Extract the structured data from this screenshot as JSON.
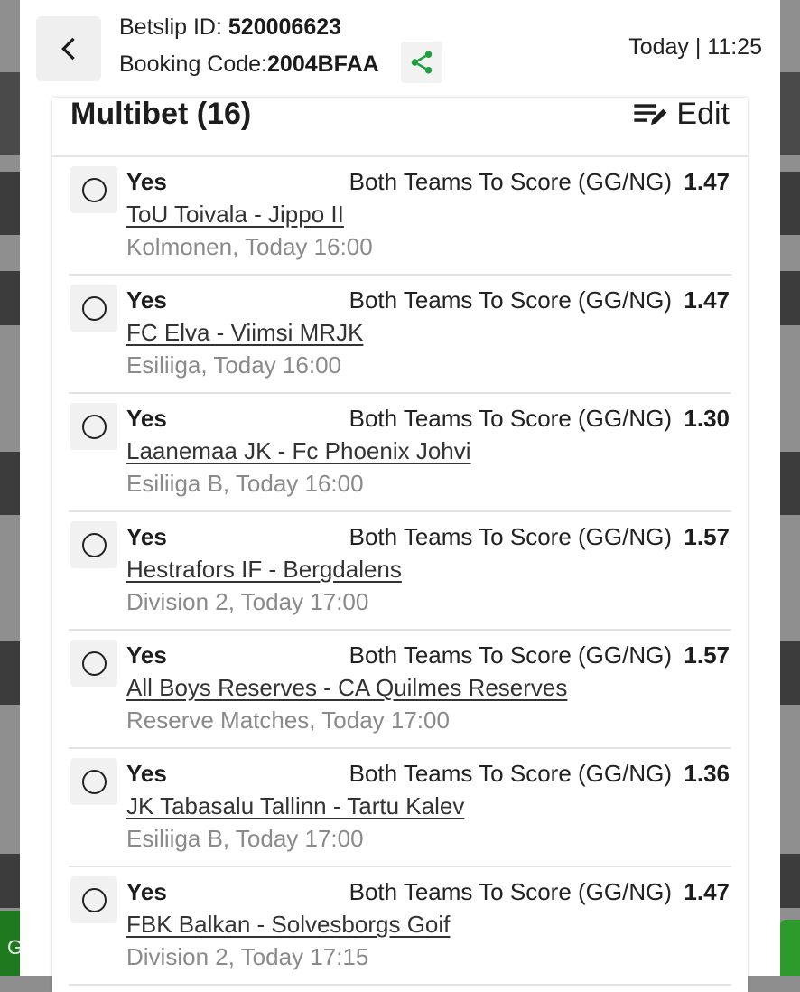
{
  "header": {
    "betslip_label": "Betslip ID:",
    "betslip_id": "520006623",
    "booking_label": "Booking Code:",
    "booking_code": "2004BFAA",
    "date_time": "Today | 11:25"
  },
  "card": {
    "title": "Multibet (16)",
    "edit_label": "Edit"
  },
  "bets": [
    {
      "pick": "Yes",
      "market": "Both Teams To Score (GG/NG)",
      "odds": "1.47",
      "match": "ToU Toivala - Jippo II",
      "league": "Kolmonen, Today 16:00"
    },
    {
      "pick": "Yes",
      "market": "Both Teams To Score (GG/NG)",
      "odds": "1.47",
      "match": "FC Elva - Viimsi MRJK",
      "league": "Esiliiga, Today 16:00"
    },
    {
      "pick": "Yes",
      "market": "Both Teams To Score (GG/NG)",
      "odds": "1.30",
      "match": "Laanemaa JK - Fc Phoenix Johvi",
      "league": "Esiliiga B, Today 16:00"
    },
    {
      "pick": "Yes",
      "market": "Both Teams To Score (GG/NG)",
      "odds": "1.57",
      "match": "Hestrafors IF - Bergdalens",
      "league": "Division 2, Today 17:00"
    },
    {
      "pick": "Yes",
      "market": "Both Teams To Score (GG/NG)",
      "odds": "1.57",
      "match": "All Boys Reserves - CA Quilmes Reserves",
      "league": "Reserve Matches, Today 17:00"
    },
    {
      "pick": "Yes",
      "market": "Both Teams To Score (GG/NG)",
      "odds": "1.36",
      "match": "JK Tabasalu Tallinn - Tartu Kalev",
      "league": "Esiliiga B, Today 17:00"
    },
    {
      "pick": "Yes",
      "market": "Both Teams To Score (GG/NG)",
      "odds": "1.47",
      "match": "FBK Balkan - Solvesborgs Goif",
      "league": "Division 2, Today 17:15"
    }
  ],
  "background": {
    "partial_text": "G"
  },
  "colors": {
    "accent_green": "#1e9e3e",
    "text_dark": "#1d1d1d",
    "text_muted": "#8a8a8a"
  }
}
